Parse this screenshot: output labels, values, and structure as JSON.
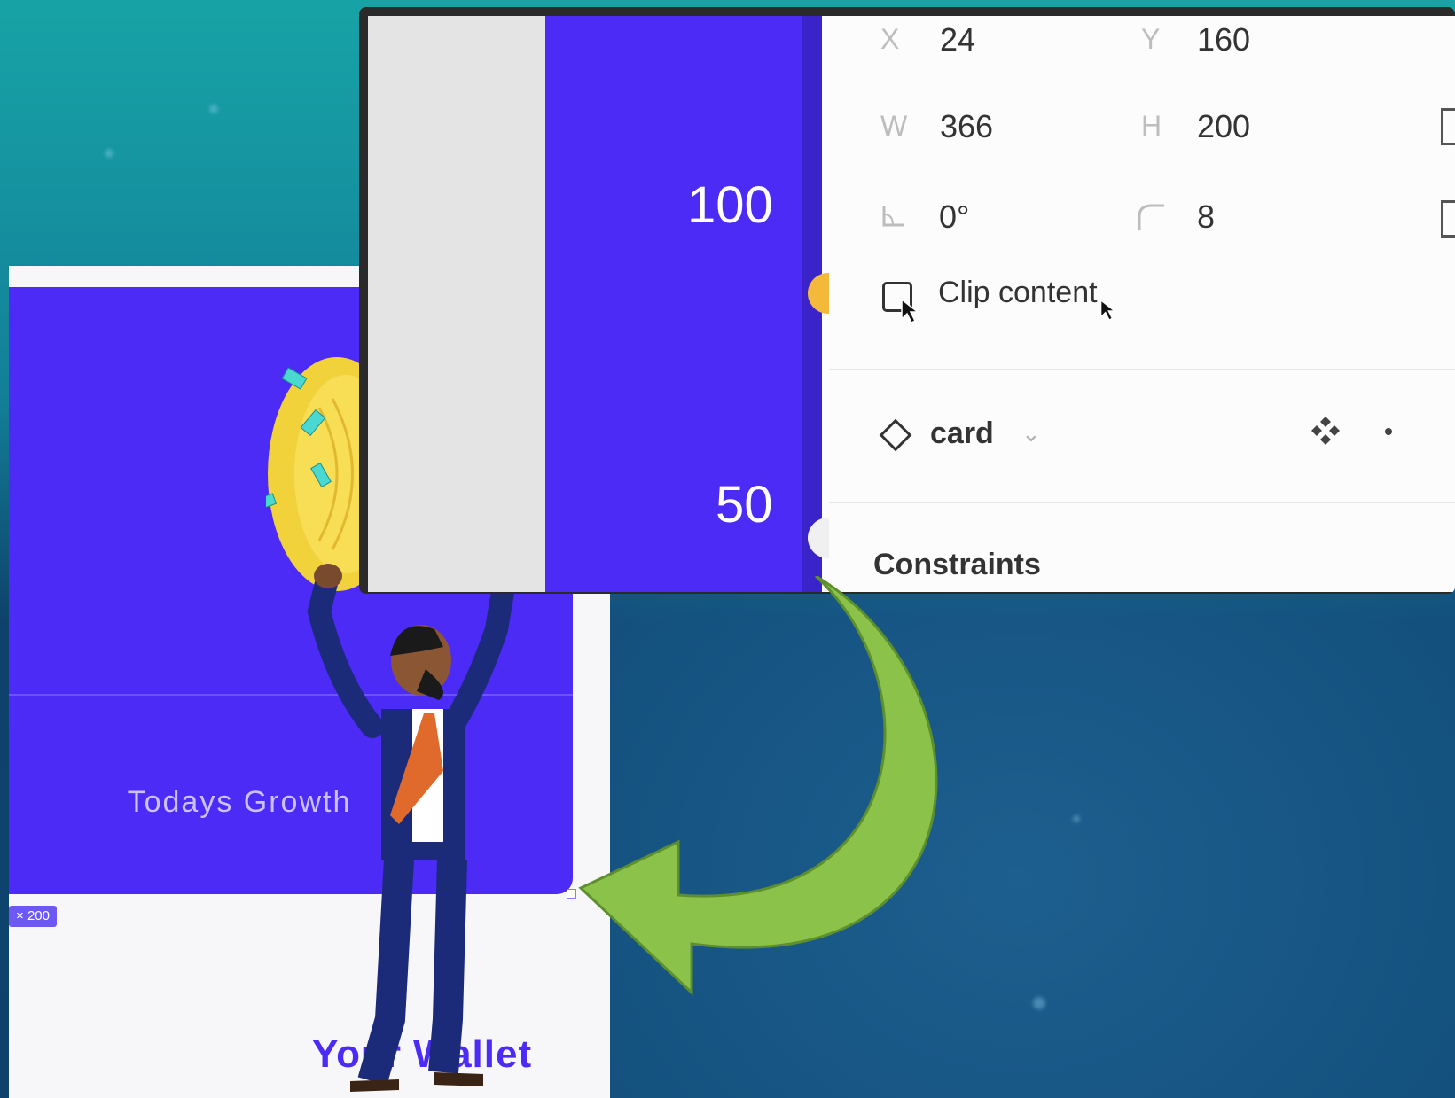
{
  "canvas": {
    "card_label": "Todays Growth",
    "size_badge": "× 200",
    "wallet_title": "Your Wallet"
  },
  "zoom": {
    "ruler_labels": [
      "100",
      "50"
    ],
    "props": {
      "x_label": "X",
      "x_value": "24",
      "y_label": "Y",
      "y_value": "160",
      "w_label": "W",
      "w_value": "366",
      "h_label": "H",
      "h_value": "200",
      "rotation_value": "0°",
      "radius_value": "8"
    },
    "clip_content_label": "Clip content",
    "component_name": "card",
    "constraints_label": "Constraints"
  },
  "colors": {
    "brand_purple": "#4b2bf5",
    "arrow_green": "#8bc34a",
    "bg_teal": "#17a3a6"
  }
}
